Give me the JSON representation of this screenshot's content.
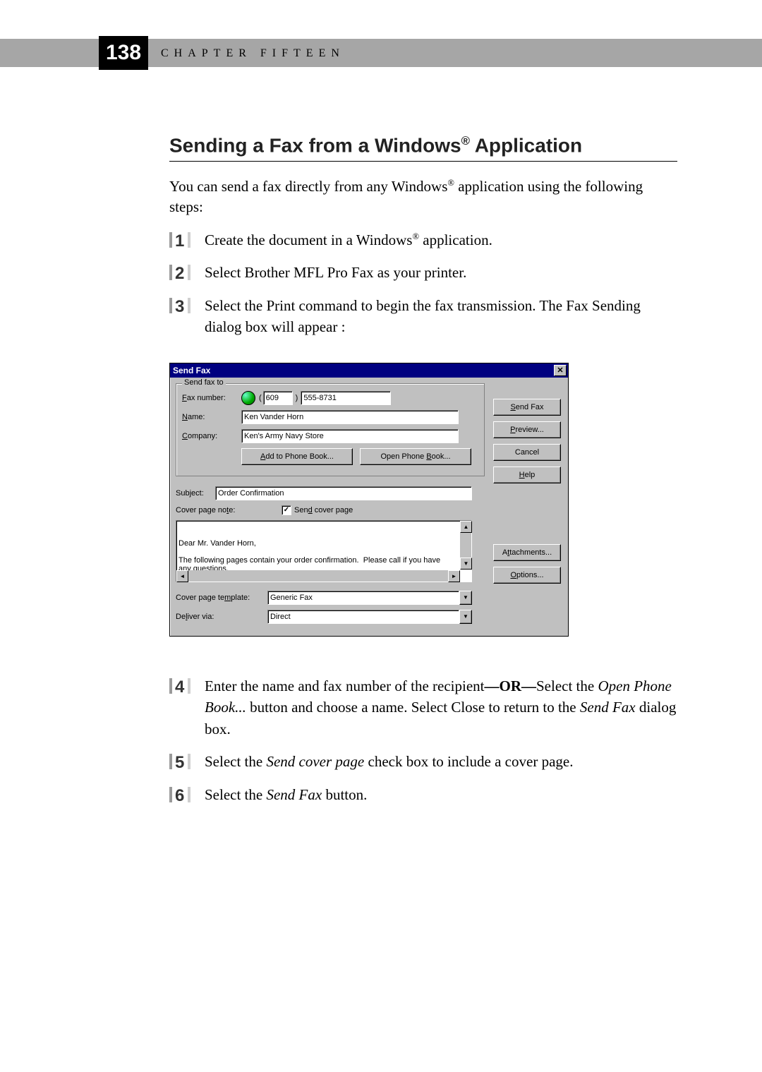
{
  "page": {
    "number": "138",
    "chapter_label": "CHAPTER FIFTEEN"
  },
  "heading": {
    "pre": "Sending a Fax from a Windows",
    "reg1": "®",
    "post": " Application"
  },
  "intro": {
    "p1a": "You can send a fax directly from any Windows",
    "reg": "®",
    "p1b": " application using the following steps:"
  },
  "steps_top": {
    "s1a": "Create the document in a Windows",
    "s1reg": "®",
    "s1b": " application.",
    "s2": "Select Brother MFL Pro Fax as your printer.",
    "s3": "Select the Print command to begin the fax transmission.  The Fax Sending dialog box will appear :"
  },
  "dlg": {
    "title": "Send Fax",
    "group_legend": "Send fax to",
    "labels": {
      "fax_number_pre": "F",
      "fax_number_post": "ax number:",
      "name_pre": "N",
      "name_post": "ame:",
      "company_pre": "C",
      "company_post": "ompany:",
      "subject_pre": "Sub",
      "subject_u": "j",
      "subject_post": "ect:",
      "cover_note_pre": "Cover page no",
      "cover_note_u": "t",
      "cover_note_post": "e:",
      "cover_tmpl_pre": "Cover page te",
      "cover_tmpl_u": "m",
      "cover_tmpl_post": "plate:",
      "deliver_pre": "De",
      "deliver_u": "l",
      "deliver_post": "iver via:"
    },
    "fax_area": "609",
    "fax_num": "555-8731",
    "name": "Ken Vander Horn",
    "company": "Ken's Army Navy Store",
    "subject": "Order Confirmation",
    "cover_text": "Dear Mr. Vander Horn,\n\nThe following pages contain your order confirmation.  Please call if you have any questions.",
    "cover_template": "Generic Fax",
    "deliver_via": "Direct",
    "send_cover": {
      "pre": "Sen",
      "u": "d",
      "post": " cover page"
    },
    "buttons": {
      "add_pb": {
        "u": "A",
        "post": "dd to Phone Book..."
      },
      "open_pb": {
        "pre": "Open Phone ",
        "u": "B",
        "post": "ook..."
      },
      "send": {
        "u": "S",
        "post": "end Fax"
      },
      "preview": {
        "u": "P",
        "post": "review..."
      },
      "cancel": "Cancel",
      "help": {
        "u": "H",
        "post": "elp"
      },
      "attach": {
        "pre": "A",
        "u": "t",
        "post": "tachments..."
      },
      "options": {
        "u": "O",
        "post": "ptions..."
      }
    }
  },
  "steps_bottom": {
    "s4a": "Enter the name and fax number of the recipient",
    "s4_or": "—OR—",
    "s4b": "Select the ",
    "s4c": "Open Phone Book...",
    "s4d": " button and choose a name.  Select Close to return to the ",
    "s4e": "Send Fax",
    "s4f": " dialog box.",
    "s5a": "Select the ",
    "s5b": "Send cover page",
    "s5c": " check box to include a cover page.",
    "s6a": "Select the ",
    "s6b": "Send Fax",
    "s6c": " button."
  },
  "step_nums": {
    "n1": "1",
    "n2": "2",
    "n3": "3",
    "n4": "4",
    "n5": "5",
    "n6": "6"
  }
}
